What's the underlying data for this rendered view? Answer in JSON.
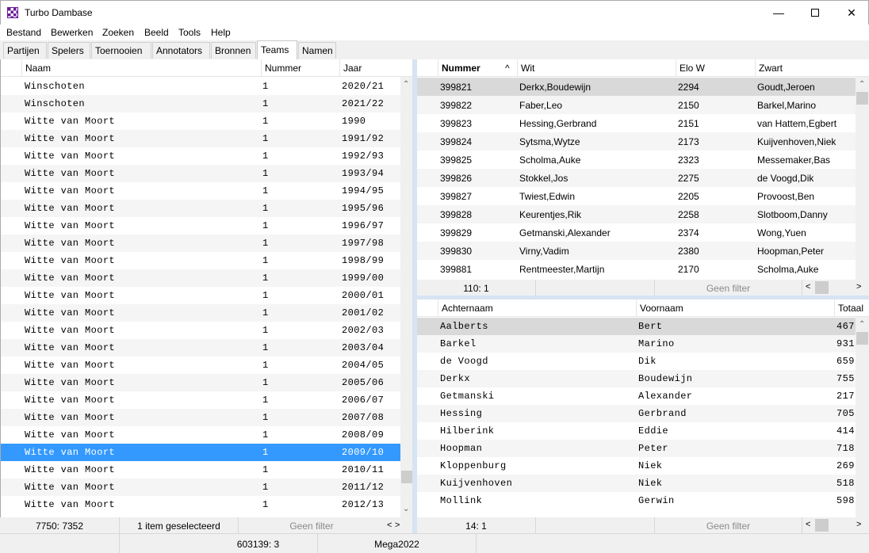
{
  "window": {
    "title": "Turbo Dambase"
  },
  "menu": [
    "Bestand",
    "Bewerken",
    "Zoeken",
    "Beeld",
    "Tools",
    "Help"
  ],
  "tabs": [
    "Partijen",
    "Spelers",
    "Toernooien",
    "Annotators",
    "Bronnen",
    "Teams",
    "Namen"
  ],
  "active_tab": "Teams",
  "teams": {
    "columns": [
      "Naam",
      "Nummer",
      "Jaar"
    ],
    "rows": [
      [
        "Winschoten",
        "1",
        "2020/21"
      ],
      [
        "Winschoten",
        "1",
        "2021/22"
      ],
      [
        "Witte van Moort",
        "1",
        "1990"
      ],
      [
        "Witte van Moort",
        "1",
        "1991/92"
      ],
      [
        "Witte van Moort",
        "1",
        "1992/93"
      ],
      [
        "Witte van Moort",
        "1",
        "1993/94"
      ],
      [
        "Witte van Moort",
        "1",
        "1994/95"
      ],
      [
        "Witte van Moort",
        "1",
        "1995/96"
      ],
      [
        "Witte van Moort",
        "1",
        "1996/97"
      ],
      [
        "Witte van Moort",
        "1",
        "1997/98"
      ],
      [
        "Witte van Moort",
        "1",
        "1998/99"
      ],
      [
        "Witte van Moort",
        "1",
        "1999/00"
      ],
      [
        "Witte van Moort",
        "1",
        "2000/01"
      ],
      [
        "Witte van Moort",
        "1",
        "2001/02"
      ],
      [
        "Witte van Moort",
        "1",
        "2002/03"
      ],
      [
        "Witte van Moort",
        "1",
        "2003/04"
      ],
      [
        "Witte van Moort",
        "1",
        "2004/05"
      ],
      [
        "Witte van Moort",
        "1",
        "2005/06"
      ],
      [
        "Witte van Moort",
        "1",
        "2006/07"
      ],
      [
        "Witte van Moort",
        "1",
        "2007/08"
      ],
      [
        "Witte van Moort",
        "1",
        "2008/09"
      ],
      [
        "Witte van Moort",
        "1",
        "2009/10"
      ],
      [
        "Witte van Moort",
        "1",
        "2010/11"
      ],
      [
        "Witte van Moort",
        "1",
        "2011/12"
      ],
      [
        "Witte van Moort",
        "1",
        "2012/13"
      ]
    ],
    "selected_row": 21,
    "status": [
      "7750: 7352",
      "1 item geselecteerd",
      "Geen filter"
    ]
  },
  "games": {
    "columns": [
      "Nummer",
      "Wit",
      "Elo W",
      "Zwart"
    ],
    "sort_indicator": "^",
    "rows": [
      [
        "399821",
        "Derkx,Boudewijn",
        "2294",
        "Goudt,Jeroen"
      ],
      [
        "399822",
        "Faber,Leo",
        "2150",
        "Barkel,Marino"
      ],
      [
        "399823",
        "Hessing,Gerbrand",
        "2151",
        "van Hattem,Egbert"
      ],
      [
        "399824",
        "Sytsma,Wytze",
        "2173",
        "Kuijvenhoven,Niek"
      ],
      [
        "399825",
        "Scholma,Auke",
        "2323",
        "Messemaker,Bas"
      ],
      [
        "399826",
        "Stokkel,Jos",
        "2275",
        "de Voogd,Dik"
      ],
      [
        "399827",
        "Twiest,Edwin",
        "2205",
        "Provoost,Ben"
      ],
      [
        "399828",
        "Keurentjes,Rik",
        "2258",
        "Slotboom,Danny"
      ],
      [
        "399829",
        "Getmanski,Alexander",
        "2374",
        "Wong,Yuen"
      ],
      [
        "399830",
        "Virny,Vadim",
        "2380",
        "Hoopman,Peter"
      ],
      [
        "399881",
        "Rentmeester,Martijn",
        "2170",
        "Scholma,Auke"
      ]
    ],
    "selected_row": 0,
    "status": [
      "110: 1",
      "Geen filter"
    ]
  },
  "players": {
    "columns": [
      "Achternaam",
      "Voornaam",
      "Totaal"
    ],
    "rows": [
      [
        "Aalberts",
        "Bert",
        "467"
      ],
      [
        "Barkel",
        "Marino",
        "931"
      ],
      [
        "de Voogd",
        "Dik",
        "659"
      ],
      [
        "Derkx",
        "Boudewijn",
        "755"
      ],
      [
        "Getmanski",
        "Alexander",
        "217"
      ],
      [
        "Hessing",
        "Gerbrand",
        "705"
      ],
      [
        "Hilberink",
        "Eddie",
        "414"
      ],
      [
        "Hoopman",
        "Peter",
        "718"
      ],
      [
        "Kloppenburg",
        "Niek",
        "269"
      ],
      [
        "Kuijvenhoven",
        "Niek",
        "518"
      ],
      [
        "Mollink",
        "Gerwin",
        "598"
      ]
    ],
    "selected_row": 0,
    "status": [
      "14: 1",
      "Geen filter"
    ]
  },
  "statusbar": [
    "",
    "603139: 3",
    "Mega2022"
  ]
}
